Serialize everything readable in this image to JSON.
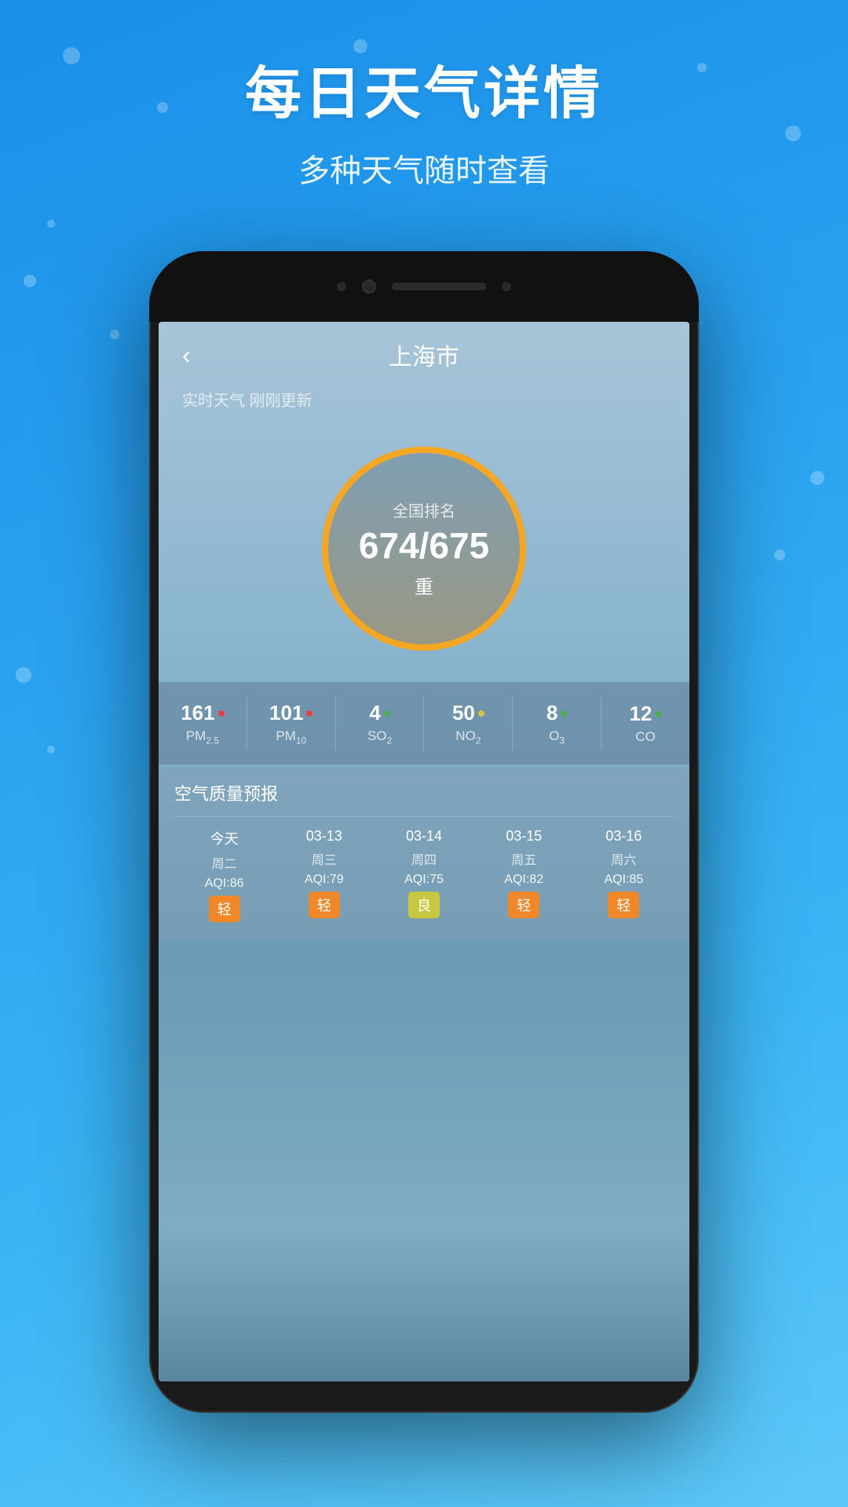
{
  "background": {
    "color_start": "#1a8fe8",
    "color_end": "#5ec8f8"
  },
  "header": {
    "main_title": "每日天气详情",
    "sub_title": "多种天气随时查看"
  },
  "phone": {
    "topbar": {
      "back_label": "‹",
      "city_name": "上海市"
    },
    "realtime_label": "实时天气 刚刚更新",
    "aqi_circle": {
      "rank_label": "全国排名",
      "rank_value": "674/675",
      "level": "重"
    },
    "pollutants": [
      {
        "value": "161",
        "dot_class": "dot-red",
        "name": "PM",
        "sub": "2.5"
      },
      {
        "value": "101",
        "dot_class": "dot-red",
        "name": "PM",
        "sub": "10"
      },
      {
        "value": "4",
        "dot_class": "dot-green",
        "name": "SO",
        "sub": "2"
      },
      {
        "value": "50",
        "dot_class": "dot-yellow",
        "name": "NO",
        "sub": "2"
      },
      {
        "value": "8",
        "dot_class": "dot-green",
        "name": "O",
        "sub": "3"
      },
      {
        "value": "12",
        "dot_class": "dot-green",
        "name": "CO",
        "sub": ""
      }
    ],
    "forecast": {
      "title": "空气质量预报",
      "columns": [
        {
          "date": "今天",
          "weekday": "周二",
          "aqi": "AQI:86",
          "badge": "轻",
          "badge_class": "badge-orange"
        },
        {
          "date": "03-13",
          "weekday": "周三",
          "aqi": "AQI:79",
          "badge": "轻",
          "badge_class": "badge-orange"
        },
        {
          "date": "03-14",
          "weekday": "周四",
          "aqi": "AQI:75",
          "badge": "良",
          "badge_class": "badge-yellow-green"
        },
        {
          "date": "03-15",
          "weekday": "周五",
          "aqi": "AQI:82",
          "badge": "轻",
          "badge_class": "badge-orange"
        },
        {
          "date": "03-16",
          "weekday": "周六",
          "aqi": "AQI:85",
          "badge": "轻",
          "badge_class": "badge-orange"
        }
      ]
    }
  }
}
